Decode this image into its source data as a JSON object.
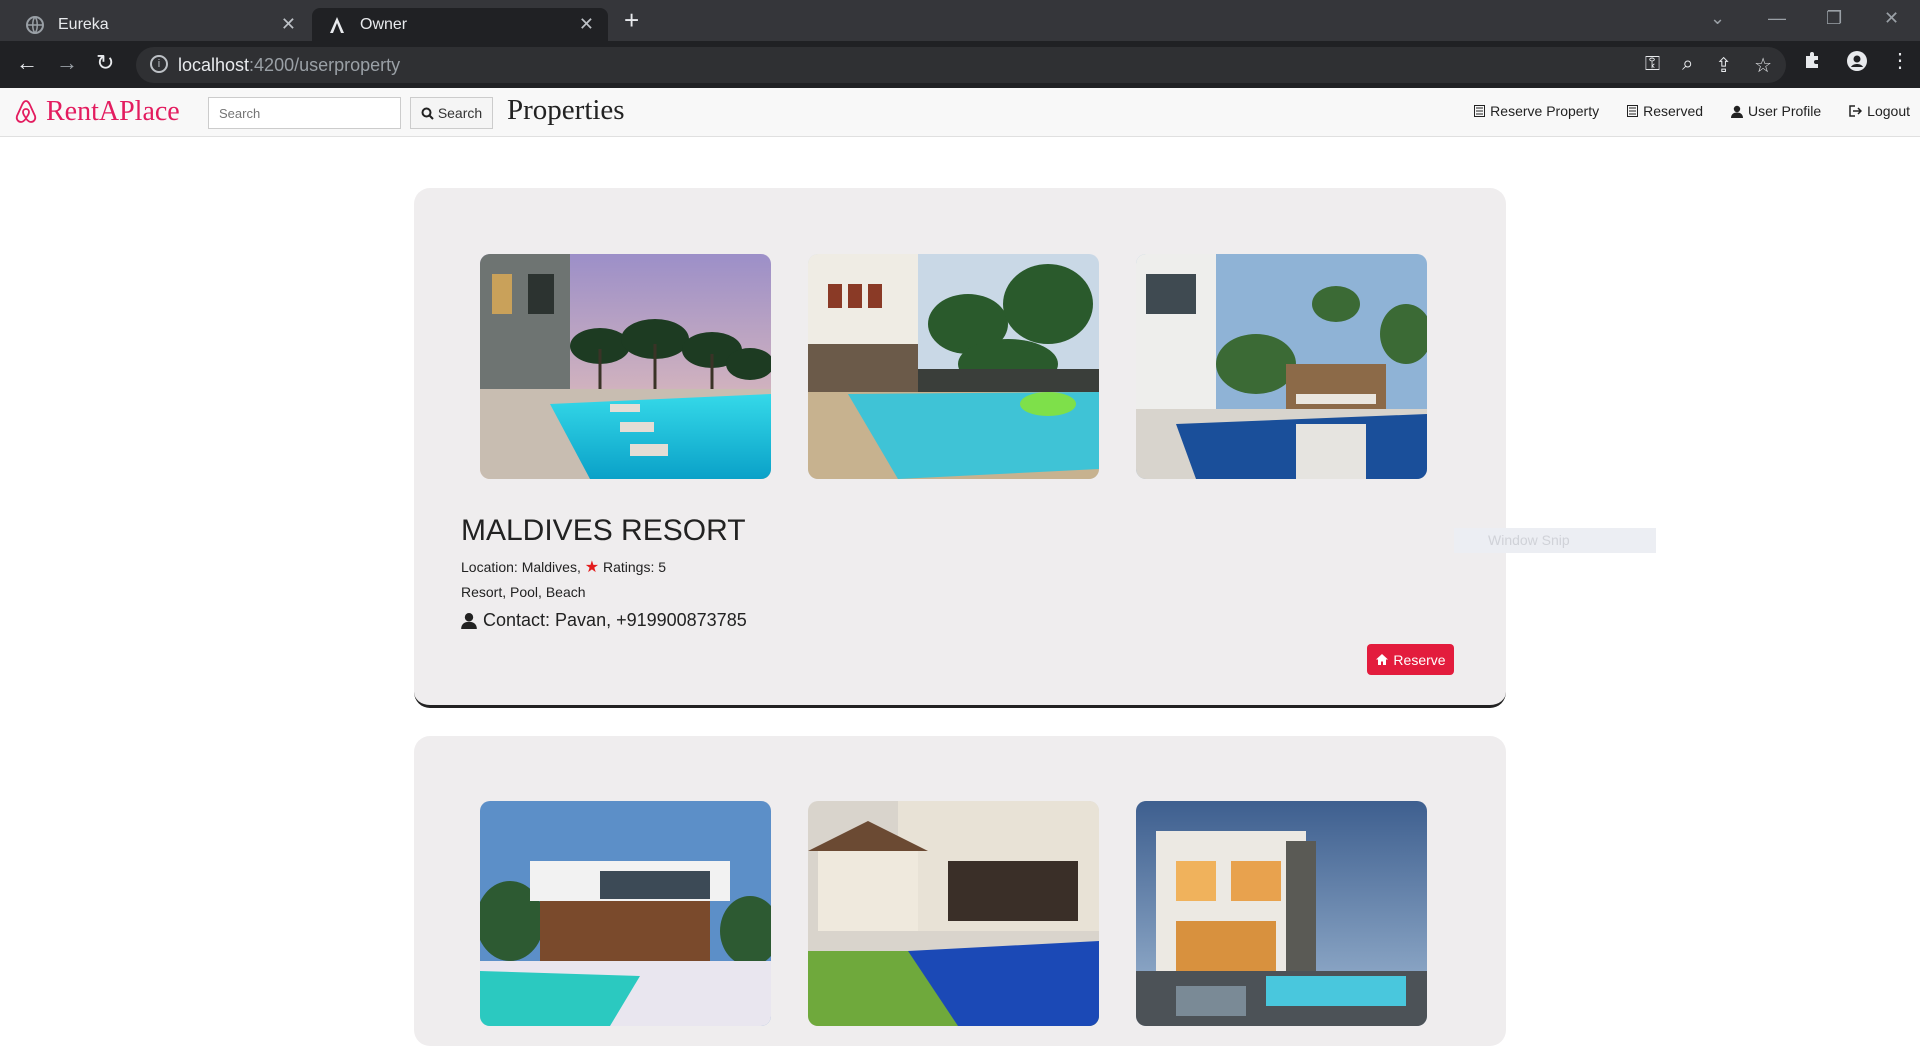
{
  "browser": {
    "tabs": [
      {
        "title": "Eureka",
        "icon": "globe-icon"
      },
      {
        "title": "Owner",
        "icon": "angular-icon"
      }
    ],
    "url_host": "localhost",
    "url_path": ":4200/userproperty"
  },
  "app": {
    "brand": "RentAPlace",
    "search_placeholder": "Search",
    "search_button": "Search",
    "page_title": "Properties",
    "nav": {
      "reserve_property": "Reserve Property",
      "reserved": "Reserved",
      "user_profile": "User Profile",
      "logout": "Logout"
    },
    "accent": "#e31c5f"
  },
  "properties": [
    {
      "name": "MALDIVES RESORT",
      "location_label": "Location: Maldives,",
      "ratings_label": "Ratings: 5",
      "tags": "Resort, Pool, Beach",
      "contact": "Contact: Pavan, +919900873785",
      "reserve_label": "Reserve"
    }
  ],
  "overlay": {
    "snip_label": "Window Snip"
  }
}
